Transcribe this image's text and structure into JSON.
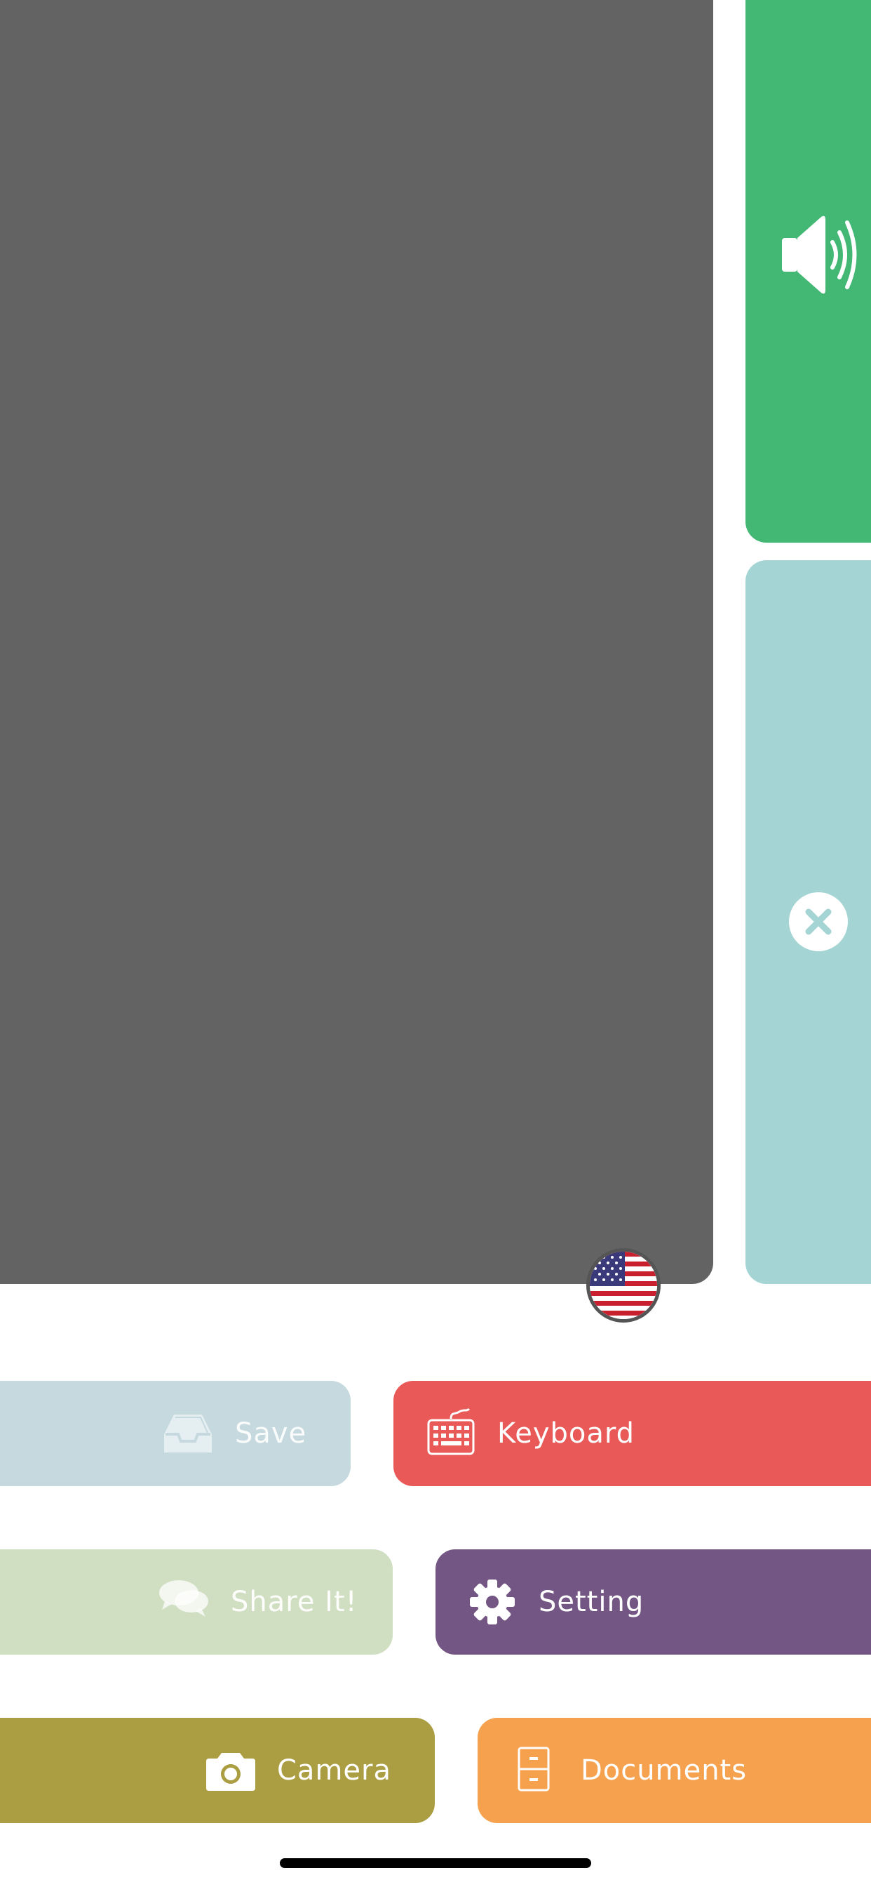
{
  "panels": {
    "text_area": {
      "color": "#636363"
    },
    "speak": {
      "color": "#42b874",
      "icon": "speaker-volume-icon"
    },
    "clear": {
      "color": "#a4d4d3",
      "icon": "close-circle-icon"
    }
  },
  "language": {
    "icon": "us-flag-icon"
  },
  "buttons": {
    "save": {
      "label": "Save",
      "icon": "inbox-tray-icon",
      "color": "#c5d9df"
    },
    "keyboard": {
      "label": "Keyboard",
      "icon": "keyboard-icon",
      "color": "#e95958"
    },
    "share": {
      "label": "Share It!",
      "icon": "chat-bubbles-icon",
      "color": "#d0dfc2"
    },
    "setting": {
      "label": "Setting",
      "icon": "gear-icon",
      "color": "#735683"
    },
    "camera": {
      "label": "Camera",
      "icon": "camera-icon",
      "color": "#ab9d42"
    },
    "documents": {
      "label": "Documents",
      "icon": "file-cabinet-icon",
      "color": "#f6a14d"
    }
  }
}
